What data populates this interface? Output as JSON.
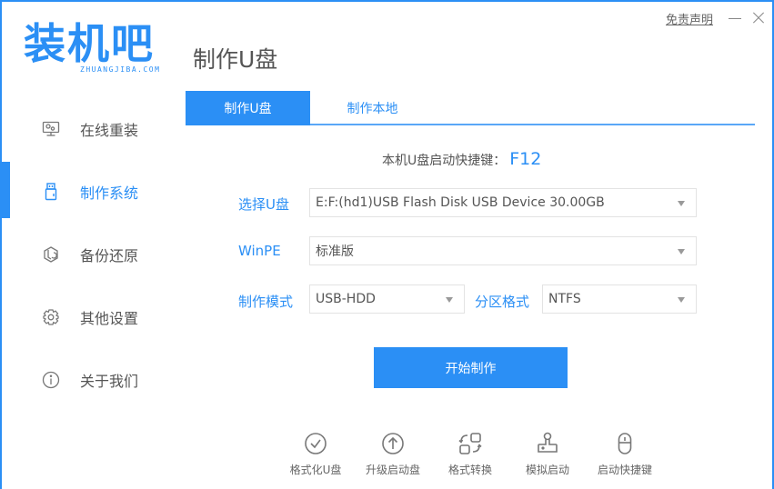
{
  "app": {
    "logo_text": "装机吧",
    "logo_domain": "ZHUANGJIBA.COM",
    "disclaimer": "免责声明",
    "accent_color": "#2b8ff5"
  },
  "window_controls": {
    "minimize_icon": "minimize-icon",
    "close_icon": "close-icon"
  },
  "sidebar": {
    "items": [
      {
        "label": "在线重装",
        "icon": "monitor-icon",
        "active": false
      },
      {
        "label": "制作系统",
        "icon": "usb-drive-icon",
        "active": true
      },
      {
        "label": "备份还原",
        "icon": "backup-cube-icon",
        "active": false
      },
      {
        "label": "其他设置",
        "icon": "gear-icon",
        "active": false
      },
      {
        "label": "关于我们",
        "icon": "info-icon",
        "active": false
      }
    ]
  },
  "main": {
    "title": "制作U盘",
    "tabs": [
      {
        "label": "制作U盘",
        "active": true
      },
      {
        "label": "制作本地",
        "active": false
      }
    ],
    "hotkey_label": "本机U盘启动快捷键：",
    "hotkey_value": "F12",
    "form": {
      "usb_label": "选择U盘",
      "usb_value": "E:F:(hd1)USB Flash Disk USB Device 30.00GB",
      "winpe_label": "WinPE",
      "winpe_value": "标准版",
      "mode_label": "制作模式",
      "mode_value": "USB-HDD",
      "partition_label": "分区格式",
      "partition_value": "NTFS"
    },
    "start_button": "开始制作",
    "tools": [
      {
        "label": "格式化U盘",
        "icon": "check-circle-icon"
      },
      {
        "label": "升级启动盘",
        "icon": "arrow-up-circle-icon"
      },
      {
        "label": "格式转换",
        "icon": "convert-icon"
      },
      {
        "label": "模拟启动",
        "icon": "joystick-icon"
      },
      {
        "label": "启动快捷键",
        "icon": "mouse-icon"
      }
    ]
  }
}
